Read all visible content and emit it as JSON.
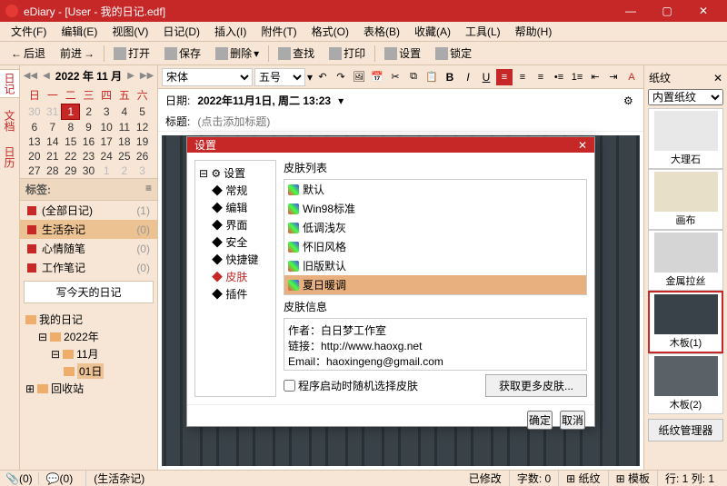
{
  "title": "eDiary - [User - 我的日记.edf]",
  "window": {
    "min": "—",
    "max": "▢",
    "close": "✕"
  },
  "menus": [
    "文件(F)",
    "编辑(E)",
    "视图(V)",
    "日记(D)",
    "插入(I)",
    "附件(T)",
    "格式(O)",
    "表格(B)",
    "收藏(A)",
    "工具(L)",
    "帮助(H)"
  ],
  "toolbar": {
    "back": "后退",
    "fwd": "前进",
    "open": "打开",
    "save": "保存",
    "del": "删除",
    "find": "查找",
    "print": "打印",
    "settings": "设置",
    "lock": "锁定"
  },
  "leftrail": [
    "日记",
    "文档",
    "日历"
  ],
  "calendar": {
    "title": "2022 年 11 月",
    "dow": [
      "日",
      "一",
      "二",
      "三",
      "四",
      "五",
      "六"
    ],
    "rows": [
      [
        "30",
        "31",
        "1",
        "2",
        "3",
        "4",
        "5"
      ],
      [
        "6",
        "7",
        "8",
        "9",
        "10",
        "11",
        "12"
      ],
      [
        "13",
        "14",
        "15",
        "16",
        "17",
        "18",
        "19"
      ],
      [
        "20",
        "21",
        "22",
        "23",
        "24",
        "25",
        "26"
      ],
      [
        "27",
        "28",
        "29",
        "30",
        "1",
        "2",
        "3"
      ]
    ],
    "today": "1",
    "grayBefore": 2,
    "grayAfter": 3
  },
  "tags": {
    "header": "标签:",
    "items": [
      {
        "name": "(全部日记)",
        "count": "(1)"
      },
      {
        "name": "生活杂记",
        "count": "(0)",
        "sel": true
      },
      {
        "name": "心情随笔",
        "count": "(0)"
      },
      {
        "name": "工作笔记",
        "count": "(0)"
      }
    ]
  },
  "todayBtn": "写今天的日记",
  "tree": {
    "root": "我的日记",
    "year": "2022年",
    "month": "11月",
    "day": "01日",
    "recycle": "回收站"
  },
  "fontSel": "宋体",
  "sizeSel": "五号",
  "dateLabel": "日期:",
  "dateValue": "2022年11月1日, 周二 13:23",
  "titleLabel": "标题:",
  "titlePlaceholder": "(点击添加标题)",
  "right": {
    "hd": "纸纹",
    "sel": "内置纸纹",
    "items": [
      "大理石",
      "画布",
      "金属拉丝",
      "木板(1)",
      "木板(2)"
    ],
    "selidx": 3,
    "mgr": "纸纹管理器"
  },
  "dialog": {
    "title": "设置",
    "tree": {
      "root": "设置",
      "items": [
        "常规",
        "编辑",
        "界面",
        "安全",
        "快捷键",
        "皮肤",
        "插件"
      ],
      "sel": "皮肤"
    },
    "listLabel": "皮肤列表",
    "skins": [
      "默认",
      "Win98标准",
      "低调浅灰",
      "怀旧风格",
      "旧版默认",
      "夏日暖调"
    ],
    "sel": 5,
    "infoLabel": "皮肤信息",
    "infoAuthor": "作者：白日梦工作室",
    "infoUrl": "链接：http://www.haoxg.net",
    "infoEmail": "Email：haoxingeng@gmail.com",
    "randChk": "程序启动时随机选择皮肤",
    "more": "获取更多皮肤...",
    "ok": "确定",
    "cancel": "取消"
  },
  "status": {
    "tabname": "(生活杂记)",
    "mod": "已修改",
    "chars": "字数: 0",
    "paper": "纸纹",
    "tpl": "模板",
    "rc": "行: 1    列: 1"
  }
}
